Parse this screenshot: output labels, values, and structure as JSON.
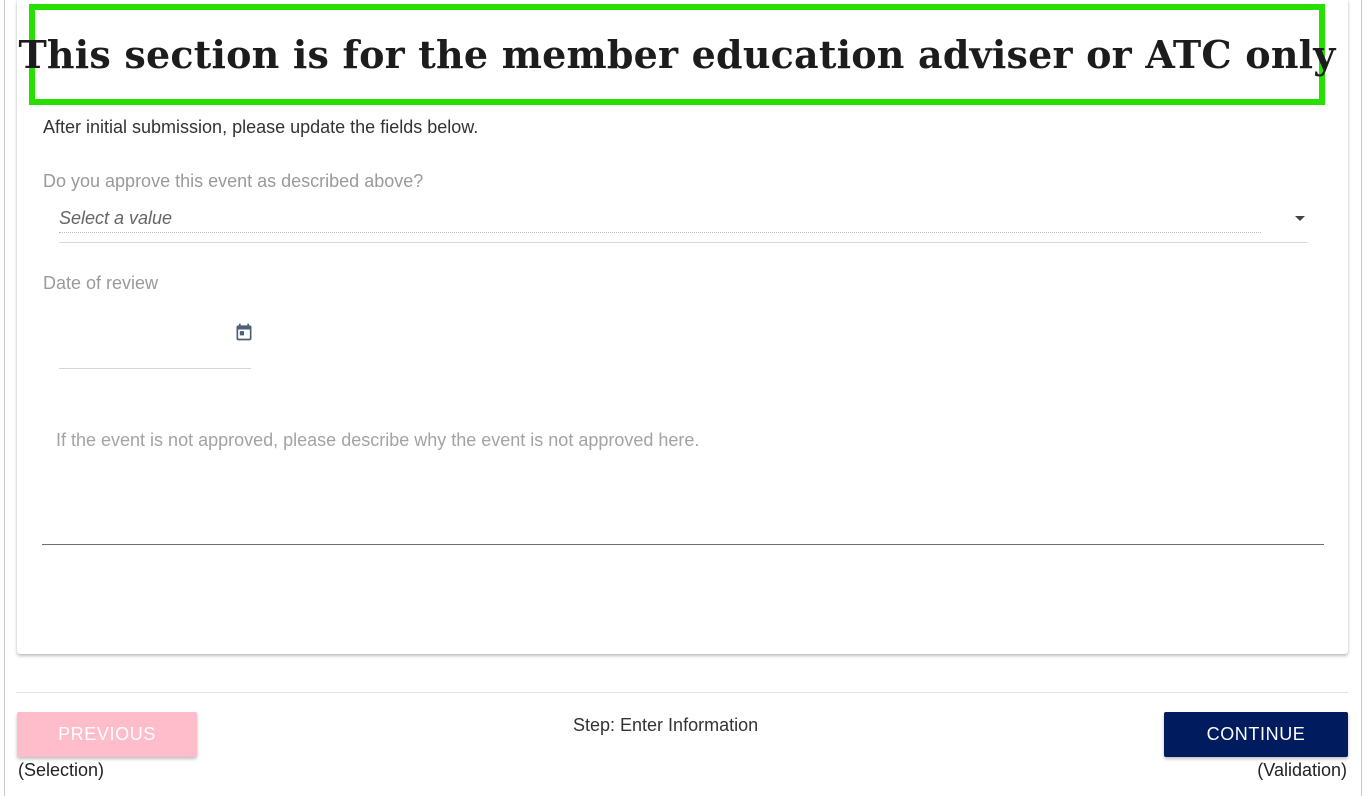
{
  "section": {
    "heading": "This section is for the member education adviser or ATC only",
    "intro": "After initial submission, please update the fields below.",
    "accent_color": "#28e000"
  },
  "approval": {
    "label": "Do you approve this event as described above?",
    "selected_value": "Select a value"
  },
  "review": {
    "label": "Date of review",
    "date_value": "",
    "icon": "calendar-icon"
  },
  "reason": {
    "placeholder": "If the event is not approved, please describe why the event is not approved here.",
    "value": ""
  },
  "footer": {
    "previous_label": "PREVIOUS",
    "previous_sub": "(Selection)",
    "step_text": "Step: Enter Information",
    "continue_label": "CONTINUE",
    "continue_sub": "(Validation)",
    "previous_color": "#ffbccb",
    "continue_color": "#001b5e"
  }
}
